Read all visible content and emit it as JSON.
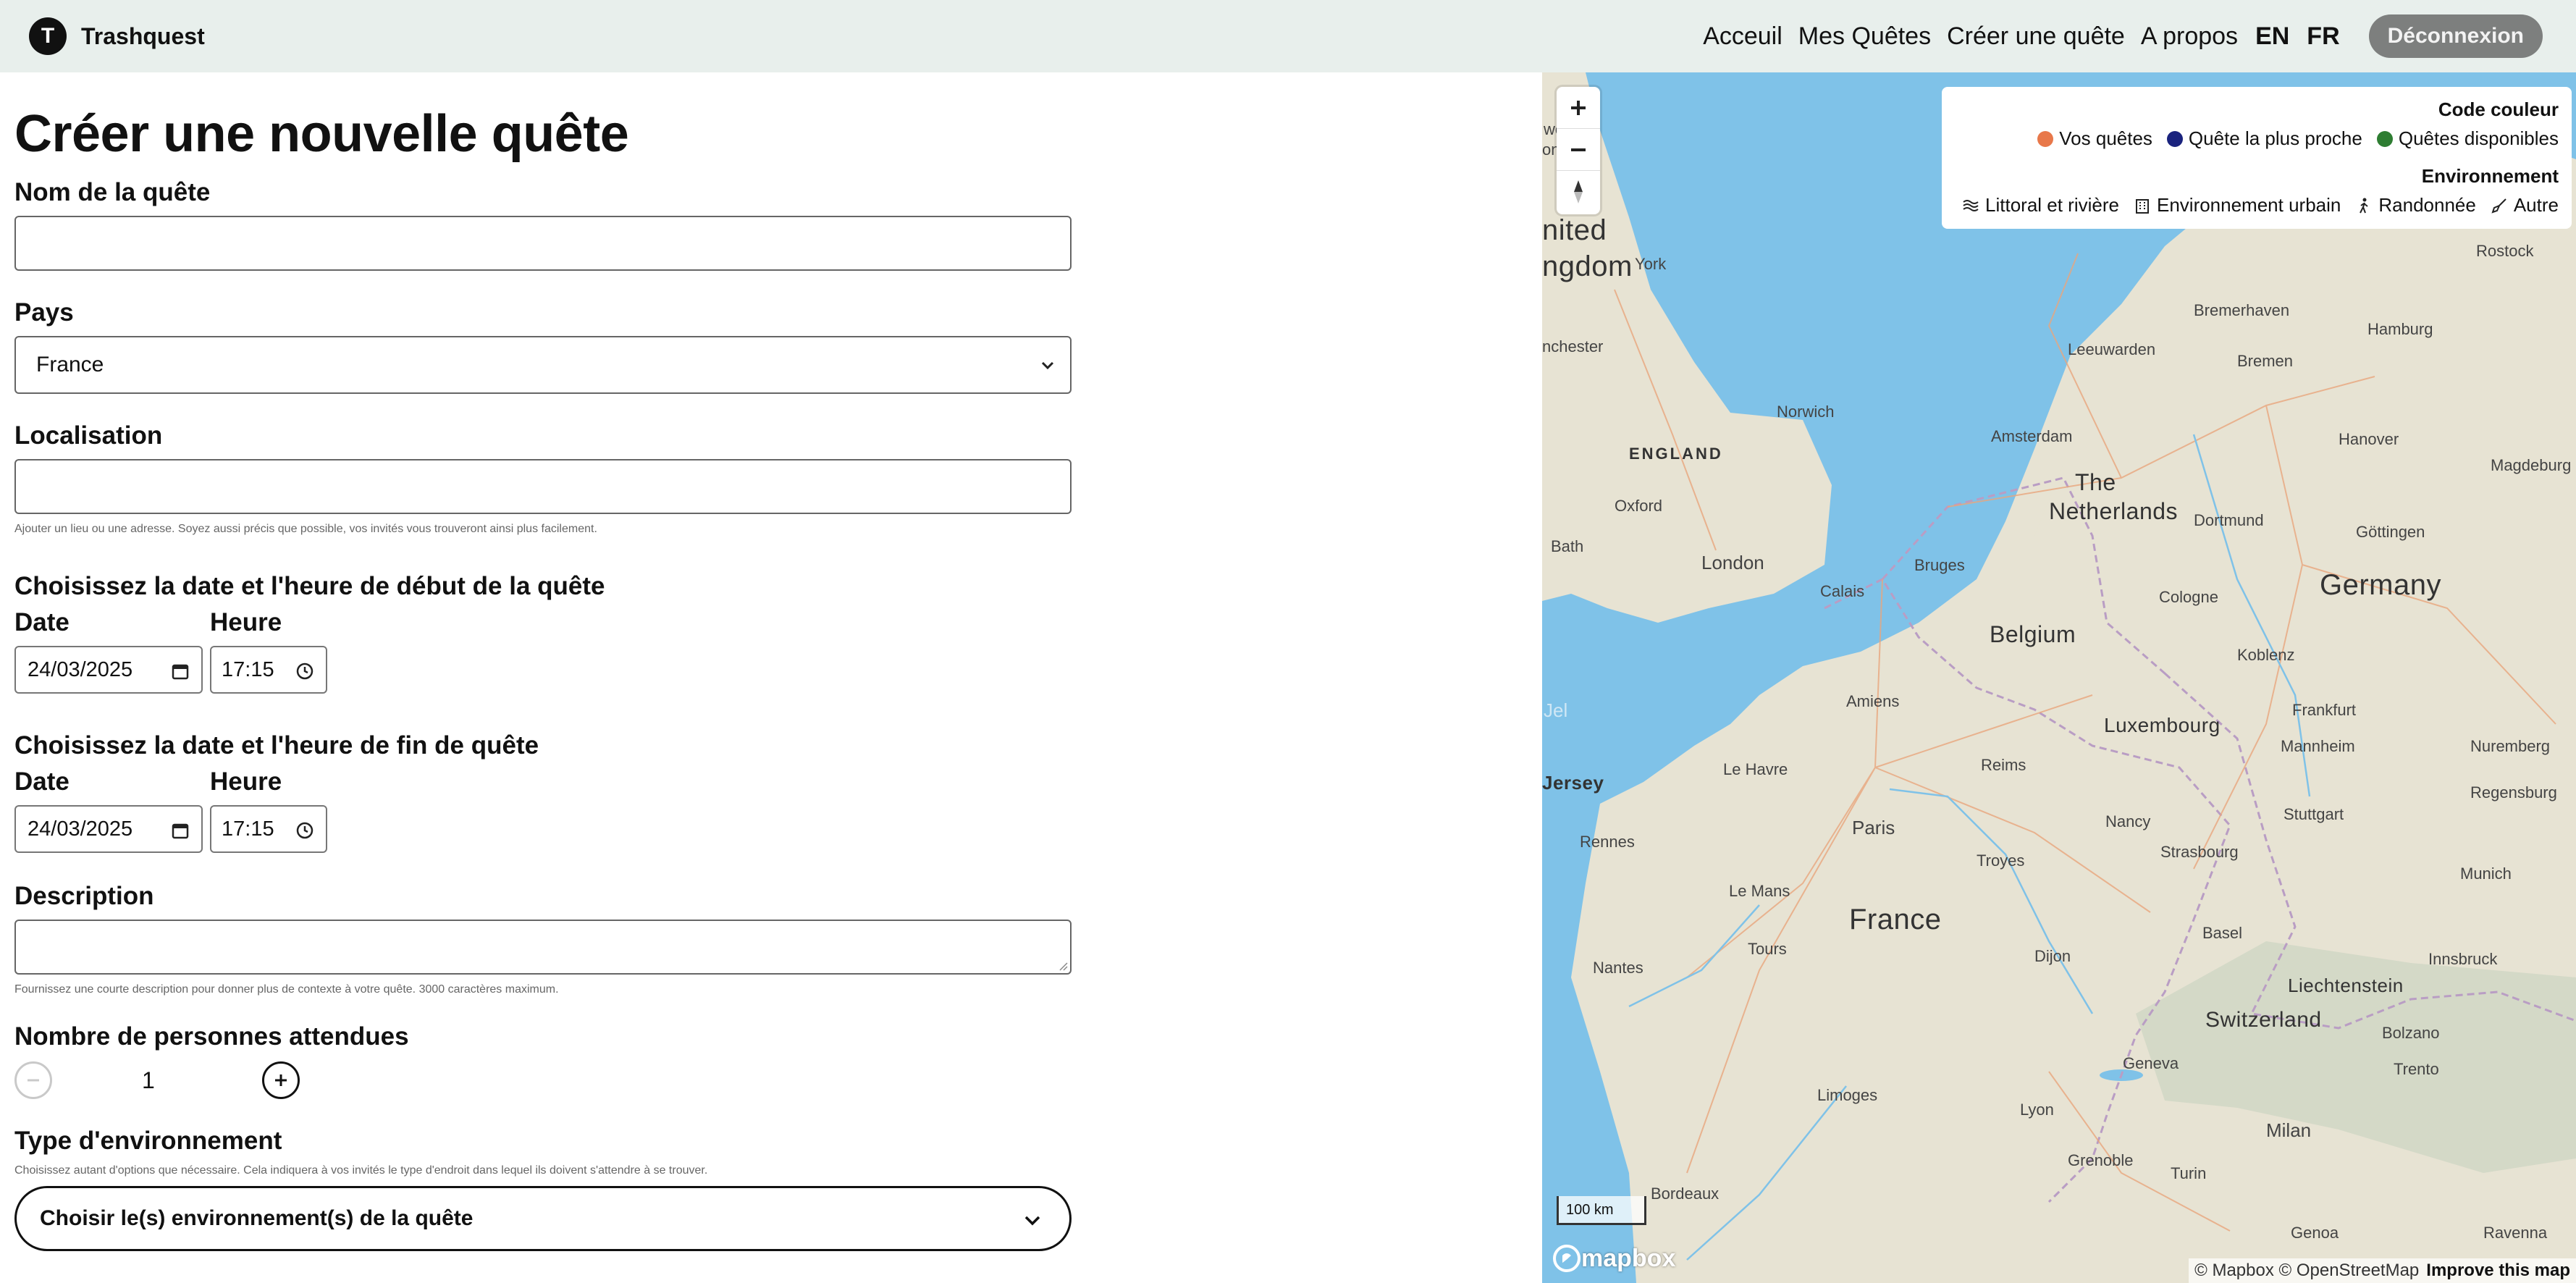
{
  "brand": {
    "logo_letter": "T",
    "name": "Trashquest"
  },
  "nav": {
    "links": [
      "Acceuil",
      "Mes Quêtes",
      "Créer une quête",
      "A propos"
    ],
    "lang_en": "EN",
    "lang_fr": "FR",
    "logout_label": "Déconnexion"
  },
  "form": {
    "title": "Créer une nouvelle quête",
    "name_label": "Nom de la quête",
    "name_value": "",
    "country_label": "Pays",
    "country_value": "France",
    "location_label": "Localisation",
    "location_value": "",
    "location_hint": "Ajouter un lieu ou une adresse. Soyez aussi précis que possible, vos invités vous trouveront ainsi plus facilement.",
    "start_section": "Choisissez la date et l'heure de début de la quête",
    "end_section": "Choisissez la date et l'heure de fin de quête",
    "date_label": "Date",
    "time_label": "Heure",
    "start_date": "24/03/2025",
    "start_time": "17:15",
    "end_date": "24/03/2025",
    "end_time": "17:15",
    "description_label": "Description",
    "description_value": "",
    "description_hint": "Fournissez une courte description pour donner plus de contexte à votre quête. 3000 caractères maximum.",
    "attendees_label": "Nombre de personnes attendues",
    "attendees_value": "1",
    "env_label": "Type d'environnement",
    "env_hint": "Choisissez autant d'options que nécessaire. Cela indiquera à vos invités le type d'endroit dans lequel ils doivent s'attendre à se trouver.",
    "env_placeholder": "Choisir le(s) environnement(s) de la quête"
  },
  "map": {
    "legend": {
      "color_title": "Code couleur",
      "colors": [
        {
          "label": "Vos quêtes",
          "color": "#e8784a"
        },
        {
          "label": "Quête la plus proche",
          "color": "#1a237e"
        },
        {
          "label": "Quêtes disponibles",
          "color": "#2e7d32"
        }
      ],
      "env_title": "Environnement",
      "envs": [
        {
          "label": "Littoral et rivière",
          "icon": "waves-icon"
        },
        {
          "label": "Environnement urbain",
          "icon": "building-icon"
        },
        {
          "label": "Randonnée",
          "icon": "hiker-icon"
        },
        {
          "label": "Autre",
          "icon": "broom-icon"
        }
      ]
    },
    "countries": [
      "nited",
      "ngdom",
      "ENGLAND",
      "The",
      "Netherlands",
      "Belgium",
      "Germany",
      "Luxembourg",
      "France",
      "Liechtenstein",
      "Switzerland",
      "Jersey"
    ],
    "cities": [
      "wcastle",
      "on Tyne",
      "York",
      "nchester",
      "Norwich",
      "Bath",
      "Oxford",
      "London",
      "Calais",
      "Bruges",
      "Amsterdam",
      "Leeuwarden",
      "Bremerhaven",
      "Hamburg",
      "Bremen",
      "Hanover",
      "Magdeburg",
      "Göttingen",
      "Cologne",
      "Dortmund",
      "Koblenz",
      "Frankfurt",
      "Mannheim",
      "Nuremberg",
      "Regensburg",
      "Amiens",
      "Le Havre",
      "Reims",
      "Paris",
      "Nancy",
      "Strasbourg",
      "Stuttgart",
      "Munich",
      "Troyes",
      "Rennes",
      "Le Mans",
      "Nantes",
      "Tours",
      "Dijon",
      "Basel",
      "Innsbruck",
      "Limoges",
      "Lyon",
      "Geneva",
      "Grenoble",
      "Turin",
      "Milan",
      "Bolzano",
      "Trento",
      "Bordeaux",
      "Genoa",
      "Ravenna",
      "Rostock",
      "Jel"
    ],
    "scale_label": "100 km",
    "mapbox_label": "mapbox",
    "attribution": "© Mapbox © OpenStreetMap",
    "improve_label": "Improve this map"
  }
}
